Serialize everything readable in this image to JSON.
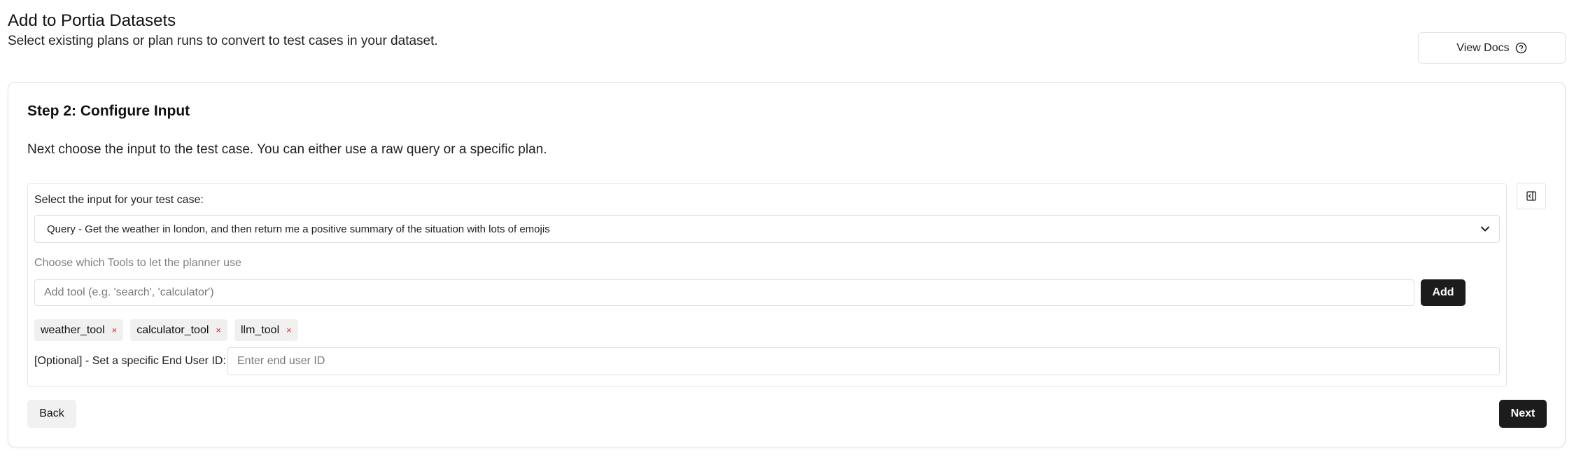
{
  "header": {
    "title": "Add to Portia Datasets",
    "subtitle": "Select existing plans or plan runs to convert to test cases in your dataset.",
    "docs_button": {
      "label": "View Docs",
      "icon": "help-circle-icon"
    }
  },
  "step": {
    "title": "Step 2: Configure Input",
    "description": "Next choose the input to the test case. You can either use a raw query or a specific plan."
  },
  "input_panel": {
    "select_label": "Select the input for your test case:",
    "selected_input": "Query - Get the weather in london, and then return me a positive summary of the situation with lots of emojis",
    "tools_label": "Choose which Tools to let the planner use",
    "tool_input": {
      "placeholder": "Add tool (e.g. 'search', 'calculator')",
      "value": ""
    },
    "add_button_label": "Add",
    "tools": [
      {
        "name": "weather_tool",
        "remove_icon": "×"
      },
      {
        "name": "calculator_tool",
        "remove_icon": "×"
      },
      {
        "name": "llm_tool",
        "remove_icon": "×"
      }
    ],
    "end_user_label": "[Optional] - Set a specific End User ID:",
    "end_user_input": {
      "placeholder": "Enter end user ID",
      "value": ""
    }
  },
  "sidebar_toggle": {
    "icon": "panel-right-icon"
  },
  "footer": {
    "back_label": "Back",
    "next_label": "Next"
  },
  "colors": {
    "primary_button": "#1c1c1c",
    "chip_background": "#f0f0f0",
    "chip_remove": "#e02424",
    "border": "#e4e4e4",
    "muted_text": "#808080"
  }
}
